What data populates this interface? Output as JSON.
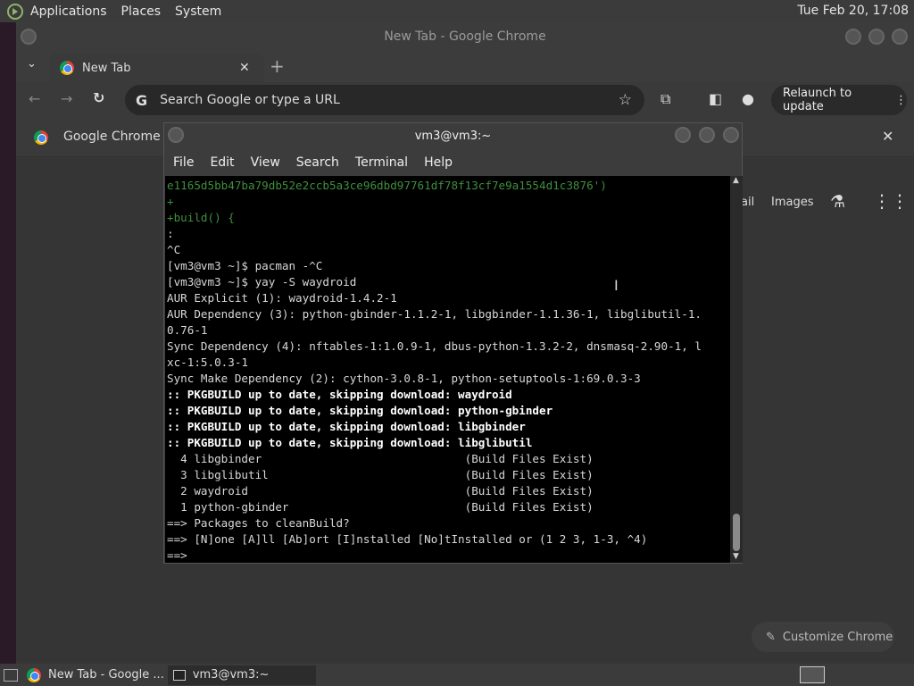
{
  "top_panel": {
    "menus": [
      "Applications",
      "Places",
      "System"
    ],
    "clock": "Tue Feb 20, 17:08"
  },
  "chrome": {
    "title": "New Tab - Google Chrome",
    "tab_label": "New Tab",
    "omnibox_placeholder": "Search Google or type a URL",
    "relaunch_label": "Relaunch to update",
    "relaunch_menu": "⋮",
    "infobar_text": "Google Chrome is",
    "links": [
      "ail",
      "Images"
    ],
    "customize_label": "Customize Chrome"
  },
  "terminal": {
    "title": "vm3@vm3:~",
    "menus": [
      "File",
      "Edit",
      "View",
      "Search",
      "Terminal",
      "Help"
    ],
    "lines": [
      {
        "t": "e1165d5bb47ba79db52e2ccb5a3ce96dbd97761df78f13cf7e9a1554d1c3876')",
        "s": "g"
      },
      {
        "t": "+",
        "s": "g"
      },
      {
        "t": "+build() {",
        "s": "g"
      },
      {
        "t": ":",
        "s": ""
      },
      {
        "t": "^C",
        "s": ""
      },
      {
        "t": "[vm3@vm3 ~]$ pacman -^C",
        "s": ""
      },
      {
        "t": "[vm3@vm3 ~]$ yay -S waydroid",
        "s": ""
      },
      {
        "t": "AUR Explicit (1): waydroid-1.4.2-1",
        "s": ""
      },
      {
        "t": "AUR Dependency (3): python-gbinder-1.1.2-1, libgbinder-1.1.36-1, libglibutil-1.",
        "s": ""
      },
      {
        "t": "0.76-1",
        "s": ""
      },
      {
        "t": "Sync Dependency (4): nftables-1:1.0.9-1, dbus-python-1.3.2-2, dnsmasq-2.90-1, l",
        "s": ""
      },
      {
        "t": "xc-1:5.0.3-1",
        "s": ""
      },
      {
        "t": "Sync Make Dependency (2): cython-3.0.8-1, python-setuptools-1:69.0.3-3",
        "s": ""
      },
      {
        "t": ":: PKGBUILD up to date, skipping download: waydroid",
        "s": "b"
      },
      {
        "t": ":: PKGBUILD up to date, skipping download: python-gbinder",
        "s": "b"
      },
      {
        "t": ":: PKGBUILD up to date, skipping download: libgbinder",
        "s": "b"
      },
      {
        "t": ":: PKGBUILD up to date, skipping download: libglibutil",
        "s": "b"
      },
      {
        "t": "  4 libgbinder                              (Build Files Exist)",
        "s": ""
      },
      {
        "t": "  3 libglibutil                             (Build Files Exist)",
        "s": ""
      },
      {
        "t": "  2 waydroid                                (Build Files Exist)",
        "s": ""
      },
      {
        "t": "  1 python-gbinder                          (Build Files Exist)",
        "s": ""
      },
      {
        "t": "==> Packages to cleanBuild?",
        "s": ""
      },
      {
        "t": "==> [N]one [A]ll [Ab]ort [I]nstalled [No]tInstalled or (1 2 3, 1-3, ^4)",
        "s": ""
      },
      {
        "t": "==>",
        "s": ""
      }
    ]
  },
  "taskbar": {
    "items": [
      "New Tab - Google ...",
      "vm3@vm3:~"
    ]
  }
}
